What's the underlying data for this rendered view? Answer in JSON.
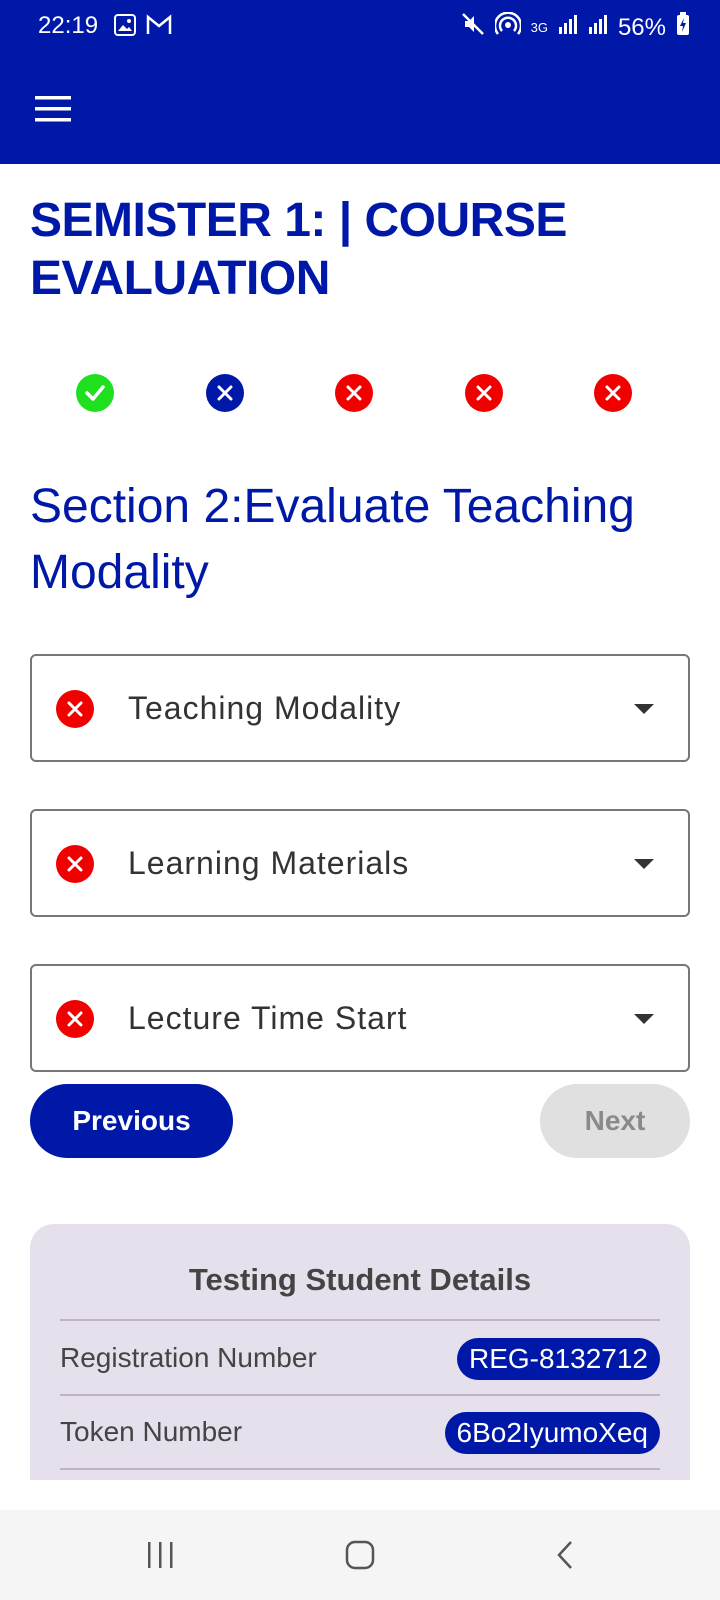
{
  "status_bar": {
    "time": "22:19",
    "battery": "56%",
    "network": "3G",
    "icons": [
      "image-icon",
      "gmail-icon",
      "mute-icon",
      "hotspot-icon",
      "signal-icon",
      "signal-icon",
      "battery-charging-icon"
    ]
  },
  "app_bar": {
    "menu_icon": "hamburger-menu-icon"
  },
  "page": {
    "title": "SEMISTER 1: | COURSE EVALUATION"
  },
  "steps": [
    {
      "state": "complete",
      "icon": "check-circle-icon",
      "color": "#1fe01f"
    },
    {
      "state": "current",
      "icon": "x-circle-icon",
      "color": "#0018a8"
    },
    {
      "state": "error",
      "icon": "x-circle-icon",
      "color": "#f10000"
    },
    {
      "state": "error",
      "icon": "x-circle-icon",
      "color": "#f10000"
    },
    {
      "state": "error",
      "icon": "x-circle-icon",
      "color": "#f10000"
    }
  ],
  "section": {
    "title": "Section 2:Evaluate Teaching Modality"
  },
  "dropdowns": [
    {
      "label": "Teaching Modality",
      "status_icon": "error-icon"
    },
    {
      "label": "Learning Materials",
      "status_icon": "error-icon"
    },
    {
      "label": "Lecture Time Start",
      "status_icon": "error-icon"
    }
  ],
  "buttons": {
    "previous": "Previous",
    "next": "Next"
  },
  "student_card": {
    "title": "Testing Student Details",
    "rows": [
      {
        "label": "Registration Number",
        "value": "REG-8132712"
      },
      {
        "label": "Token Number",
        "value": "6Bo2IyumoXeq"
      }
    ]
  },
  "colors": {
    "primary": "#0018a8",
    "error": "#f10000",
    "success": "#1fe01f",
    "card_bg": "#e6e0ec",
    "disabled": "#e0e0e0"
  },
  "nav_bar": {
    "icons": [
      "recent-apps-icon",
      "home-icon",
      "back-icon"
    ]
  }
}
